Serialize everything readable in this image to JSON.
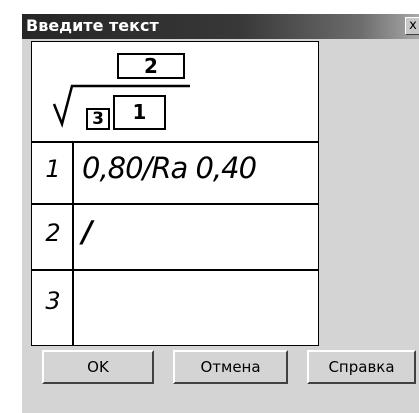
{
  "dialog": {
    "title": "Введите текст",
    "close_glyph": "x"
  },
  "symbol": {
    "field_2": "2",
    "field_3": "3",
    "field_1": "1"
  },
  "rows": [
    {
      "num": "1",
      "value": "0,80/Ra 0,40"
    },
    {
      "num": "2",
      "value": "/"
    },
    {
      "num": "3",
      "value": ""
    }
  ],
  "buttons": {
    "ok": "OK",
    "cancel": "Отмена",
    "help": "Справка"
  }
}
